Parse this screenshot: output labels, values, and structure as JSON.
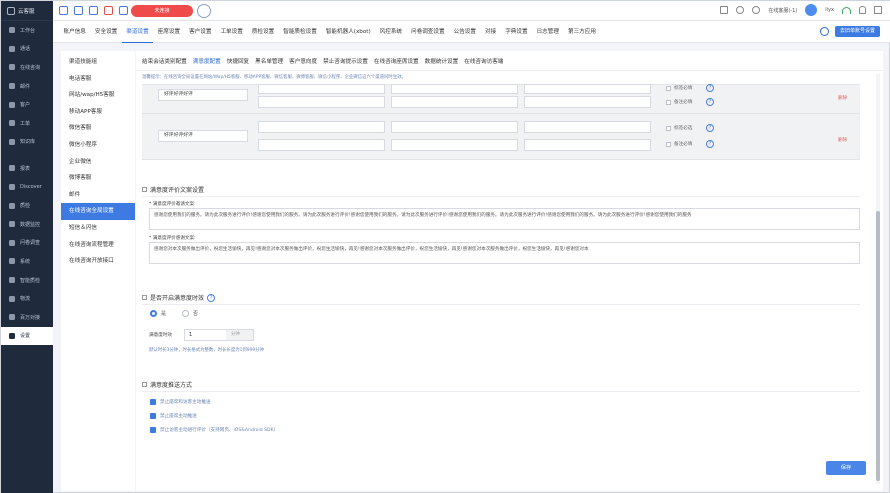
{
  "app": {
    "name": "云客服"
  },
  "rail": {
    "items": [
      {
        "label": "工作台"
      },
      {
        "label": "通话"
      },
      {
        "label": "在线咨询"
      },
      {
        "label": "邮件"
      },
      {
        "label": "客户"
      },
      {
        "label": "工单"
      },
      {
        "label": "知识库"
      },
      {
        "label": "报表"
      },
      {
        "label": "Discover"
      },
      {
        "label": "质检"
      },
      {
        "label": "数据监控"
      },
      {
        "label": "问卷调查"
      },
      {
        "label": "系统"
      },
      {
        "label": "智能质检"
      },
      {
        "label": "物流"
      },
      {
        "label": "百万对接"
      },
      {
        "label": "设置"
      }
    ]
  },
  "topbar": {
    "status_pill": "未连接",
    "agent_status": "在线客服(-1)",
    "user": "liyx"
  },
  "nav": {
    "items": [
      "账户信息",
      "安全设置",
      "渠道设置",
      "座席设置",
      "客户设置",
      "工单设置",
      "质检设置",
      "智能质检设置",
      "智能机器人(xbot)",
      "风控系统",
      "问卷调查设置",
      "公告设置",
      "对接",
      "字典设置",
      "日志管理",
      "第三方应用"
    ],
    "active_index": 2,
    "right_button": "去旧单账号设置"
  },
  "subnav": {
    "items": [
      "渠道技能组",
      "电话客服",
      "网站/wap/H5客服",
      "移动APP客服",
      "微信客服",
      "微信小程序",
      "企业微信",
      "微博客服",
      "邮件",
      "在线咨询全局设置",
      "短信＆闪信",
      "在线咨询流程管理",
      "在线咨询开放接口"
    ],
    "active_index": 9
  },
  "tabs": {
    "items": [
      "结束会话类别配置",
      "满意度配置",
      "快捷回复",
      "黑名单管理",
      "客户意向度",
      "禁止咨询提示设置",
      "在线咨询座席设置",
      "数据统计设置",
      "在线咨询访客端"
    ],
    "active_index": 1
  },
  "tip": "温馨提示：在线咨询全局设置在网站/Wap/H5客服、移动APP客服、微信客服、微博客服、微信小程序、企业微信这六个渠道同时生效。",
  "rating_rows": [
    {
      "name": "好评好评好评",
      "options": [
        "标签必填",
        "备注必填"
      ],
      "delete": "删除"
    },
    {
      "name": "好评好评好评",
      "options": [
        "标签必选",
        "备注必填"
      ],
      "delete": "删除"
    }
  ],
  "copy_section": {
    "title": "满意度评价文案设置",
    "invite_label": "* 满意度评价邀请文案:",
    "invite_text": "感谢您使用我们的服务。请为此次服务进行评价!感谢您使用我们的服务。请为此次服务进行评价!感谢您使用我们的服务。请为此次服务进行评价!感谢您使用我们的服务。请为此次服务进行评价!感谢您使用我们的服务。请为此次服务进行评价!感谢您使用我们的服务",
    "thanks_label": "* 满意度评价感谢文案:",
    "thanks_text": "感谢您对本次服务做出评价，祝您生活愉快，再见!感谢您对本次服务做出评价，祝您生活愉快，再见!感谢您对本次服务做出评价，祝您生活愉快，再见!感谢您对本次服务做出评价，祝您生活愉快，再见!感谢您对本"
  },
  "timeout_section": {
    "title": "是否开启满意度时效",
    "radio_yes": "是",
    "radio_no": "否",
    "selected": "是",
    "field_label": "满意度时效",
    "field_value": "1",
    "unit": "分钟",
    "hint": "默认时长3分钟，时长格式为整数，时长长度为1到999分钟"
  },
  "push_section": {
    "title": "满意度推送方式",
    "options": [
      "禁止座席和访客主动推送",
      "禁止座席主动推送",
      "禁止访客主动进行评价（支持网页、iOS&Android SDK）"
    ]
  },
  "save_label": "保存"
}
